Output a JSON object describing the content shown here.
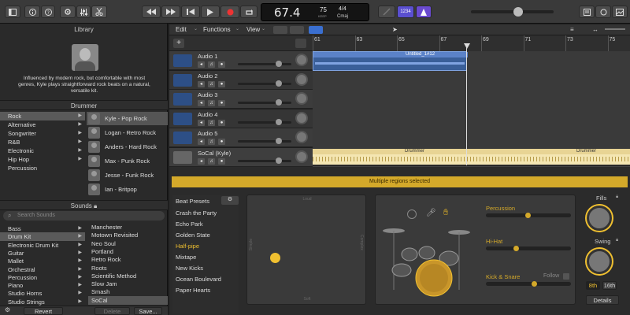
{
  "toolbar": {
    "tempo": "67.4",
    "tempo_label": "KEEP",
    "beat": "75",
    "beat_label": "TEMPO",
    "sig": "4/4",
    "key": "Cmaj",
    "counter": "1234"
  },
  "library": {
    "title": "Library",
    "description": "Influenced by modern rock, but comfortable with most genres, Kyle plays straightforward rock beats on a natural, versatile kit."
  },
  "drummer": {
    "title": "Drummer",
    "genres": [
      "Rock",
      "Alternative",
      "Songwriter",
      "R&B",
      "Electronic",
      "Hip Hop",
      "Percussion"
    ],
    "drummers": [
      "Kyle - Pop Rock",
      "Logan - Retro Rock",
      "Anders - Hard Rock",
      "Max - Punk Rock",
      "Jesse - Funk Rock",
      "Ian - Britpop"
    ]
  },
  "sounds": {
    "title": "Sounds",
    "search_placeholder": "Search Sounds",
    "categories": [
      "Bass",
      "Drum Kit",
      "Electronic Drum Kit",
      "Guitar",
      "Mallet",
      "Orchestral",
      "Percussion",
      "Piano",
      "Studio Horns",
      "Studio Strings"
    ],
    "kits": [
      "Manchester",
      "Motown Revisited",
      "Neo Soul",
      "Portland",
      "Retro Rock",
      "Roots",
      "Scientific Method",
      "Slow Jam",
      "Smash",
      "SoCal"
    ]
  },
  "library_footer": {
    "revert": "Revert",
    "delete": "Delete",
    "save": "Save..."
  },
  "menus": {
    "edit": "Edit",
    "functions": "Functions",
    "view": "View"
  },
  "ruler": [
    "61",
    "63",
    "65",
    "67",
    "69",
    "71",
    "73",
    "75"
  ],
  "tracks": [
    {
      "name": "Audio 1"
    },
    {
      "name": "Audio 2"
    },
    {
      "name": "Audio 3"
    },
    {
      "name": "Audio 4"
    },
    {
      "name": "Audio 5"
    },
    {
      "name": "SoCal (Kyle)"
    }
  ],
  "region": {
    "name": "Untitled_1#12"
  },
  "drummer_regions": [
    "Drummer",
    "Drummer"
  ],
  "editor": {
    "banner": "Multiple regions selected",
    "presets_label": "Beat Presets",
    "presets": [
      "Crash the Party",
      "Echo Park",
      "Golden State",
      "Half-pipe",
      "Mixtape",
      "New Kicks",
      "Ocean Boulevard",
      "Paper Hearts"
    ],
    "xy": {
      "loud": "Loud",
      "soft": "Soft",
      "simple": "Simple",
      "complex": "Complex"
    },
    "percussion": "Percussion",
    "hihat": "Hi-Hat",
    "kick": "Kick & Snare",
    "follow": "Follow",
    "fills": "Fills",
    "swing": "Swing",
    "eighth": "8th",
    "sixteenth": "16th",
    "details": "Details"
  },
  "colors": {
    "accent": "#f0c030",
    "region_blue": "#3a5f99",
    "drummer_region": "#f5e7b5"
  }
}
